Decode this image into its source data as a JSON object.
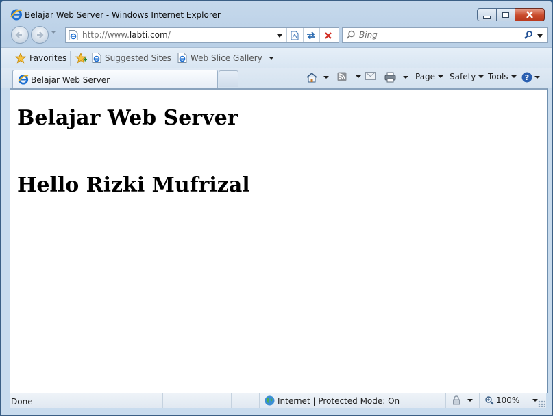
{
  "window": {
    "title": "Belajar Web Server - Windows Internet Explorer",
    "controls": [
      "minimize",
      "restore",
      "close"
    ]
  },
  "address_bar": {
    "url_prefix": "http://www.",
    "url_domain": "labti.com",
    "url_suffix": "/"
  },
  "search": {
    "placeholder": "Bing"
  },
  "favorites_bar": {
    "favorites_label": "Favorites",
    "items": [
      {
        "label": "Suggested Sites",
        "icon": "ie-page-icon"
      },
      {
        "label": "Web Slice Gallery",
        "icon": "ie-page-icon"
      }
    ]
  },
  "tabs": [
    {
      "label": "Belajar Web Server",
      "active": true
    }
  ],
  "command_bar": {
    "page_label": "Page",
    "safety_label": "Safety",
    "tools_label": "Tools"
  },
  "page": {
    "heading1": "Belajar Web Server",
    "heading2": "Hello Rizki Mufrizal"
  },
  "status_bar": {
    "status": "Done",
    "zone": "Internet | Protected Mode: On",
    "zoom": "100%"
  },
  "colors": {
    "frame": "#c6d9ec",
    "close_button": "#c94b2c",
    "ie_logo": "#1d6fd1"
  }
}
